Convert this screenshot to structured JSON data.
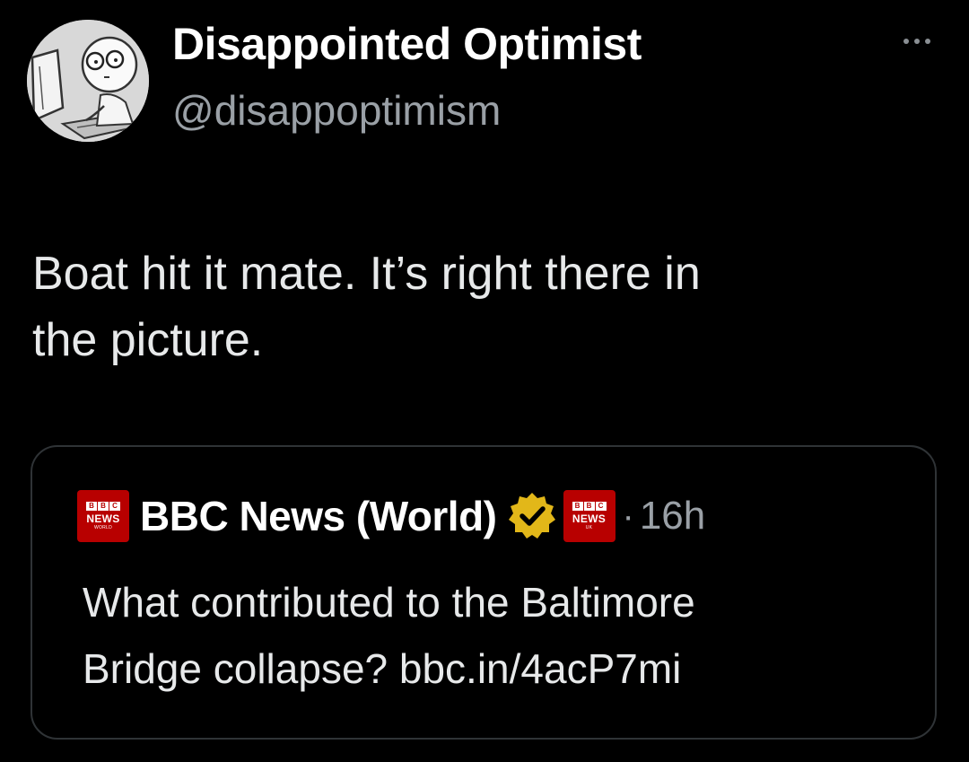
{
  "author": {
    "display_name": "Disappointed Optimist",
    "handle": "@disappoptimism",
    "avatar_icon": "cartoon-avatar"
  },
  "tweet": {
    "text_line1": "Boat hit it mate. It’s right there in",
    "text_line2": "the picture."
  },
  "menu": {
    "icon": "more-options-icon"
  },
  "quote": {
    "display_name": "BBC News (World)",
    "verified_badge": "verified-gold-badge",
    "time_separator": "·",
    "time": "16h",
    "logo_text": "NEWS",
    "logo_sub": "WORLD",
    "affiliate_logo_text": "NEWS",
    "affiliate_logo_sub": "UK",
    "text_line1": "What contributed to the Baltimore",
    "text_line2": "Bridge collapse? bbc.in/4acP7mi"
  },
  "colors": {
    "background": "#000000",
    "text": "#e7e9ea",
    "secondary_text": "#9aa0a6",
    "border": "#2f3336",
    "bbc_red": "#b80000",
    "verified_gold": "#e2b719"
  }
}
